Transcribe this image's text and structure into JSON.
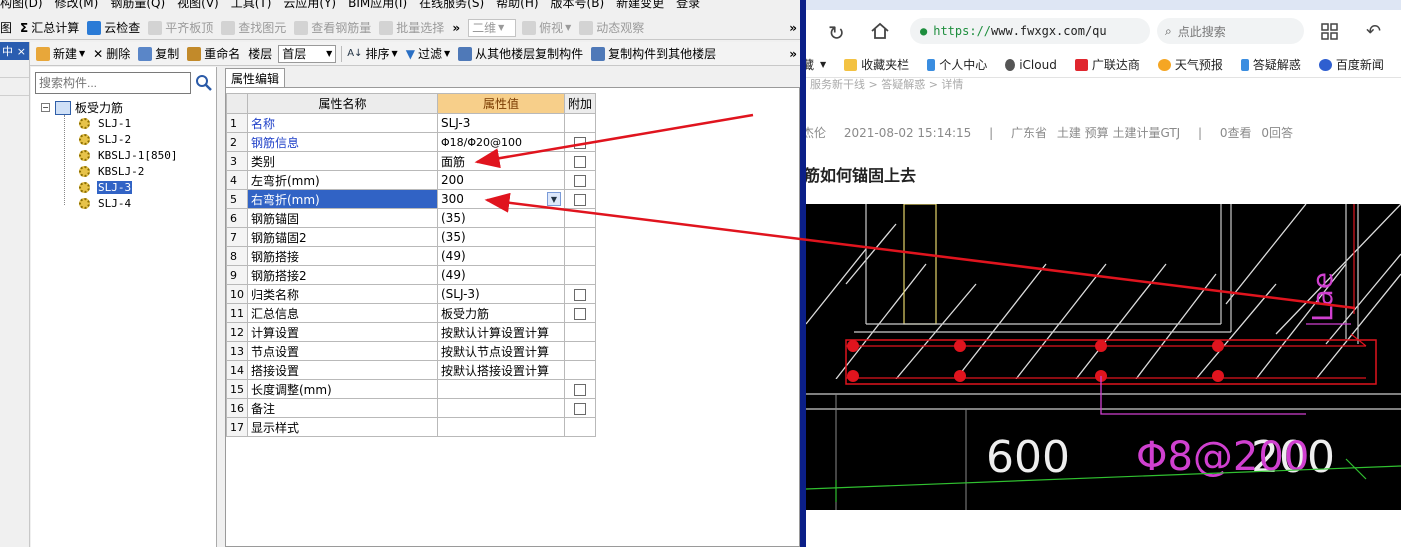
{
  "app": {
    "menu": [
      "构图(D)",
      "修改(M)",
      "钢筋量(Q)",
      "视图(V)",
      "工具(T)",
      "云应用(Y)",
      "BIM应用(I)",
      "在线服务(S)",
      "帮助(H)",
      "版本号(B)",
      "新建变更",
      "登录"
    ],
    "toolbar1": {
      "tab_prefix": "图",
      "sum_calc": "汇总计算",
      "cloud_check": "云检查",
      "align_slab": "平齐板顶",
      "find_element": "查找图元",
      "view_rebar": "查看钢筋量",
      "batch_select": "批量选择",
      "view_mode": "二维",
      "top_view": "俯视",
      "dynamic_view": "动态观察"
    },
    "toolbar2": {
      "new": "新建",
      "delete": "删除",
      "copy": "复制",
      "rename": "重命名",
      "floor_label": "楼层",
      "floor_value": "首层",
      "sort": "排序",
      "filter": "过滤",
      "copy_from_floor": "从其他楼层复制构件",
      "copy_to_floor": "复制构件到其他楼层"
    },
    "side_strip": {
      "close": "×"
    },
    "tree": {
      "search_placeholder": "搜索构件...",
      "root": "板受力筋",
      "items": [
        "SLJ-1",
        "SLJ-2",
        "KBSLJ-1[850]",
        "KBSLJ-2",
        "SLJ-3",
        "SLJ-4"
      ],
      "selected": "SLJ-3"
    },
    "props": {
      "tab": "属性编辑",
      "headers": {
        "name": "属性名称",
        "value": "属性值",
        "add": "附加"
      },
      "rows": [
        {
          "n": "1",
          "name": "名称",
          "value": "SLJ-3"
        },
        {
          "n": "2",
          "name": "钢筋信息",
          "value": "Φ18/Φ20@100"
        },
        {
          "n": "3",
          "name": "类别",
          "value": "面筋"
        },
        {
          "n": "4",
          "name": "左弯折(mm)",
          "value": "200"
        },
        {
          "n": "5",
          "name": "右弯折(mm)",
          "value": "300"
        },
        {
          "n": "6",
          "name": "钢筋锚固",
          "value": "(35)"
        },
        {
          "n": "7",
          "name": "钢筋锚固2",
          "value": "(35)"
        },
        {
          "n": "8",
          "name": "钢筋搭接",
          "value": "(49)"
        },
        {
          "n": "9",
          "name": "钢筋搭接2",
          "value": "(49)"
        },
        {
          "n": "10",
          "name": "归类名称",
          "value": "(SLJ-3)"
        },
        {
          "n": "11",
          "name": "汇总信息",
          "value": "板受力筋"
        },
        {
          "n": "12",
          "name": "计算设置",
          "value": "按默认计算设置计算"
        },
        {
          "n": "13",
          "name": "节点设置",
          "value": "按默认节点设置计算"
        },
        {
          "n": "14",
          "name": "搭接设置",
          "value": "按默认搭接设置计算"
        },
        {
          "n": "15",
          "name": "长度调整(mm)",
          "value": ""
        },
        {
          "n": "16",
          "name": "备注",
          "value": ""
        },
        {
          "n": "17",
          "name": "显示样式",
          "value": ""
        }
      ]
    }
  },
  "browser": {
    "url_scheme": "https://",
    "url_host": "www.fwxgx.com/qu",
    "search_placeholder": "点此搜索",
    "bookmarks": [
      "藏",
      "收藏夹栏",
      "个人中心",
      "iCloud",
      "广联达商",
      "天气预报",
      "答疑解惑",
      "百度新闻"
    ],
    "breadcrumb": "服务新干线 > 答疑解惑 > 详情",
    "meta": {
      "author": "杰伦",
      "time": "2021-08-02 15:14:15",
      "province": "广东省",
      "tags": "土建 预算 土建计量GTJ",
      "views": "0查看",
      "answers": "0回答"
    },
    "question_title": "筋如何锚固上去",
    "cad": {
      "dim_text_1": "600",
      "dim_text_2": "200",
      "rebar_label": "Φ8@200",
      "lae_label": "Lae"
    }
  },
  "colors": {
    "selection": "#3163c5",
    "arrow": "#e0141e",
    "cad_bg": "#000000",
    "window_divider": "#0b1f88"
  }
}
